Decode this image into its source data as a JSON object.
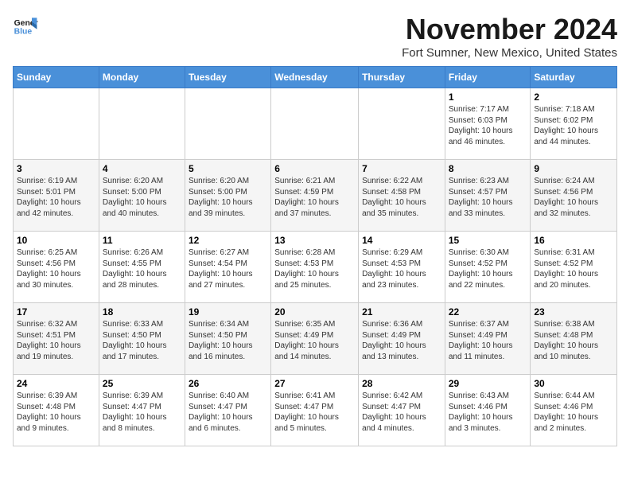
{
  "logo": {
    "line1": "General",
    "line2": "Blue"
  },
  "title": "November 2024",
  "location": "Fort Sumner, New Mexico, United States",
  "weekdays": [
    "Sunday",
    "Monday",
    "Tuesday",
    "Wednesday",
    "Thursday",
    "Friday",
    "Saturday"
  ],
  "weeks": [
    [
      {
        "day": "",
        "info": ""
      },
      {
        "day": "",
        "info": ""
      },
      {
        "day": "",
        "info": ""
      },
      {
        "day": "",
        "info": ""
      },
      {
        "day": "",
        "info": ""
      },
      {
        "day": "1",
        "info": "Sunrise: 7:17 AM\nSunset: 6:03 PM\nDaylight: 10 hours\nand 46 minutes."
      },
      {
        "day": "2",
        "info": "Sunrise: 7:18 AM\nSunset: 6:02 PM\nDaylight: 10 hours\nand 44 minutes."
      }
    ],
    [
      {
        "day": "3",
        "info": "Sunrise: 6:19 AM\nSunset: 5:01 PM\nDaylight: 10 hours\nand 42 minutes."
      },
      {
        "day": "4",
        "info": "Sunrise: 6:20 AM\nSunset: 5:00 PM\nDaylight: 10 hours\nand 40 minutes."
      },
      {
        "day": "5",
        "info": "Sunrise: 6:20 AM\nSunset: 5:00 PM\nDaylight: 10 hours\nand 39 minutes."
      },
      {
        "day": "6",
        "info": "Sunrise: 6:21 AM\nSunset: 4:59 PM\nDaylight: 10 hours\nand 37 minutes."
      },
      {
        "day": "7",
        "info": "Sunrise: 6:22 AM\nSunset: 4:58 PM\nDaylight: 10 hours\nand 35 minutes."
      },
      {
        "day": "8",
        "info": "Sunrise: 6:23 AM\nSunset: 4:57 PM\nDaylight: 10 hours\nand 33 minutes."
      },
      {
        "day": "9",
        "info": "Sunrise: 6:24 AM\nSunset: 4:56 PM\nDaylight: 10 hours\nand 32 minutes."
      }
    ],
    [
      {
        "day": "10",
        "info": "Sunrise: 6:25 AM\nSunset: 4:56 PM\nDaylight: 10 hours\nand 30 minutes."
      },
      {
        "day": "11",
        "info": "Sunrise: 6:26 AM\nSunset: 4:55 PM\nDaylight: 10 hours\nand 28 minutes."
      },
      {
        "day": "12",
        "info": "Sunrise: 6:27 AM\nSunset: 4:54 PM\nDaylight: 10 hours\nand 27 minutes."
      },
      {
        "day": "13",
        "info": "Sunrise: 6:28 AM\nSunset: 4:53 PM\nDaylight: 10 hours\nand 25 minutes."
      },
      {
        "day": "14",
        "info": "Sunrise: 6:29 AM\nSunset: 4:53 PM\nDaylight: 10 hours\nand 23 minutes."
      },
      {
        "day": "15",
        "info": "Sunrise: 6:30 AM\nSunset: 4:52 PM\nDaylight: 10 hours\nand 22 minutes."
      },
      {
        "day": "16",
        "info": "Sunrise: 6:31 AM\nSunset: 4:52 PM\nDaylight: 10 hours\nand 20 minutes."
      }
    ],
    [
      {
        "day": "17",
        "info": "Sunrise: 6:32 AM\nSunset: 4:51 PM\nDaylight: 10 hours\nand 19 minutes."
      },
      {
        "day": "18",
        "info": "Sunrise: 6:33 AM\nSunset: 4:50 PM\nDaylight: 10 hours\nand 17 minutes."
      },
      {
        "day": "19",
        "info": "Sunrise: 6:34 AM\nSunset: 4:50 PM\nDaylight: 10 hours\nand 16 minutes."
      },
      {
        "day": "20",
        "info": "Sunrise: 6:35 AM\nSunset: 4:49 PM\nDaylight: 10 hours\nand 14 minutes."
      },
      {
        "day": "21",
        "info": "Sunrise: 6:36 AM\nSunset: 4:49 PM\nDaylight: 10 hours\nand 13 minutes."
      },
      {
        "day": "22",
        "info": "Sunrise: 6:37 AM\nSunset: 4:49 PM\nDaylight: 10 hours\nand 11 minutes."
      },
      {
        "day": "23",
        "info": "Sunrise: 6:38 AM\nSunset: 4:48 PM\nDaylight: 10 hours\nand 10 minutes."
      }
    ],
    [
      {
        "day": "24",
        "info": "Sunrise: 6:39 AM\nSunset: 4:48 PM\nDaylight: 10 hours\nand 9 minutes."
      },
      {
        "day": "25",
        "info": "Sunrise: 6:39 AM\nSunset: 4:47 PM\nDaylight: 10 hours\nand 8 minutes."
      },
      {
        "day": "26",
        "info": "Sunrise: 6:40 AM\nSunset: 4:47 PM\nDaylight: 10 hours\nand 6 minutes."
      },
      {
        "day": "27",
        "info": "Sunrise: 6:41 AM\nSunset: 4:47 PM\nDaylight: 10 hours\nand 5 minutes."
      },
      {
        "day": "28",
        "info": "Sunrise: 6:42 AM\nSunset: 4:47 PM\nDaylight: 10 hours\nand 4 minutes."
      },
      {
        "day": "29",
        "info": "Sunrise: 6:43 AM\nSunset: 4:46 PM\nDaylight: 10 hours\nand 3 minutes."
      },
      {
        "day": "30",
        "info": "Sunrise: 6:44 AM\nSunset: 4:46 PM\nDaylight: 10 hours\nand 2 minutes."
      }
    ]
  ]
}
